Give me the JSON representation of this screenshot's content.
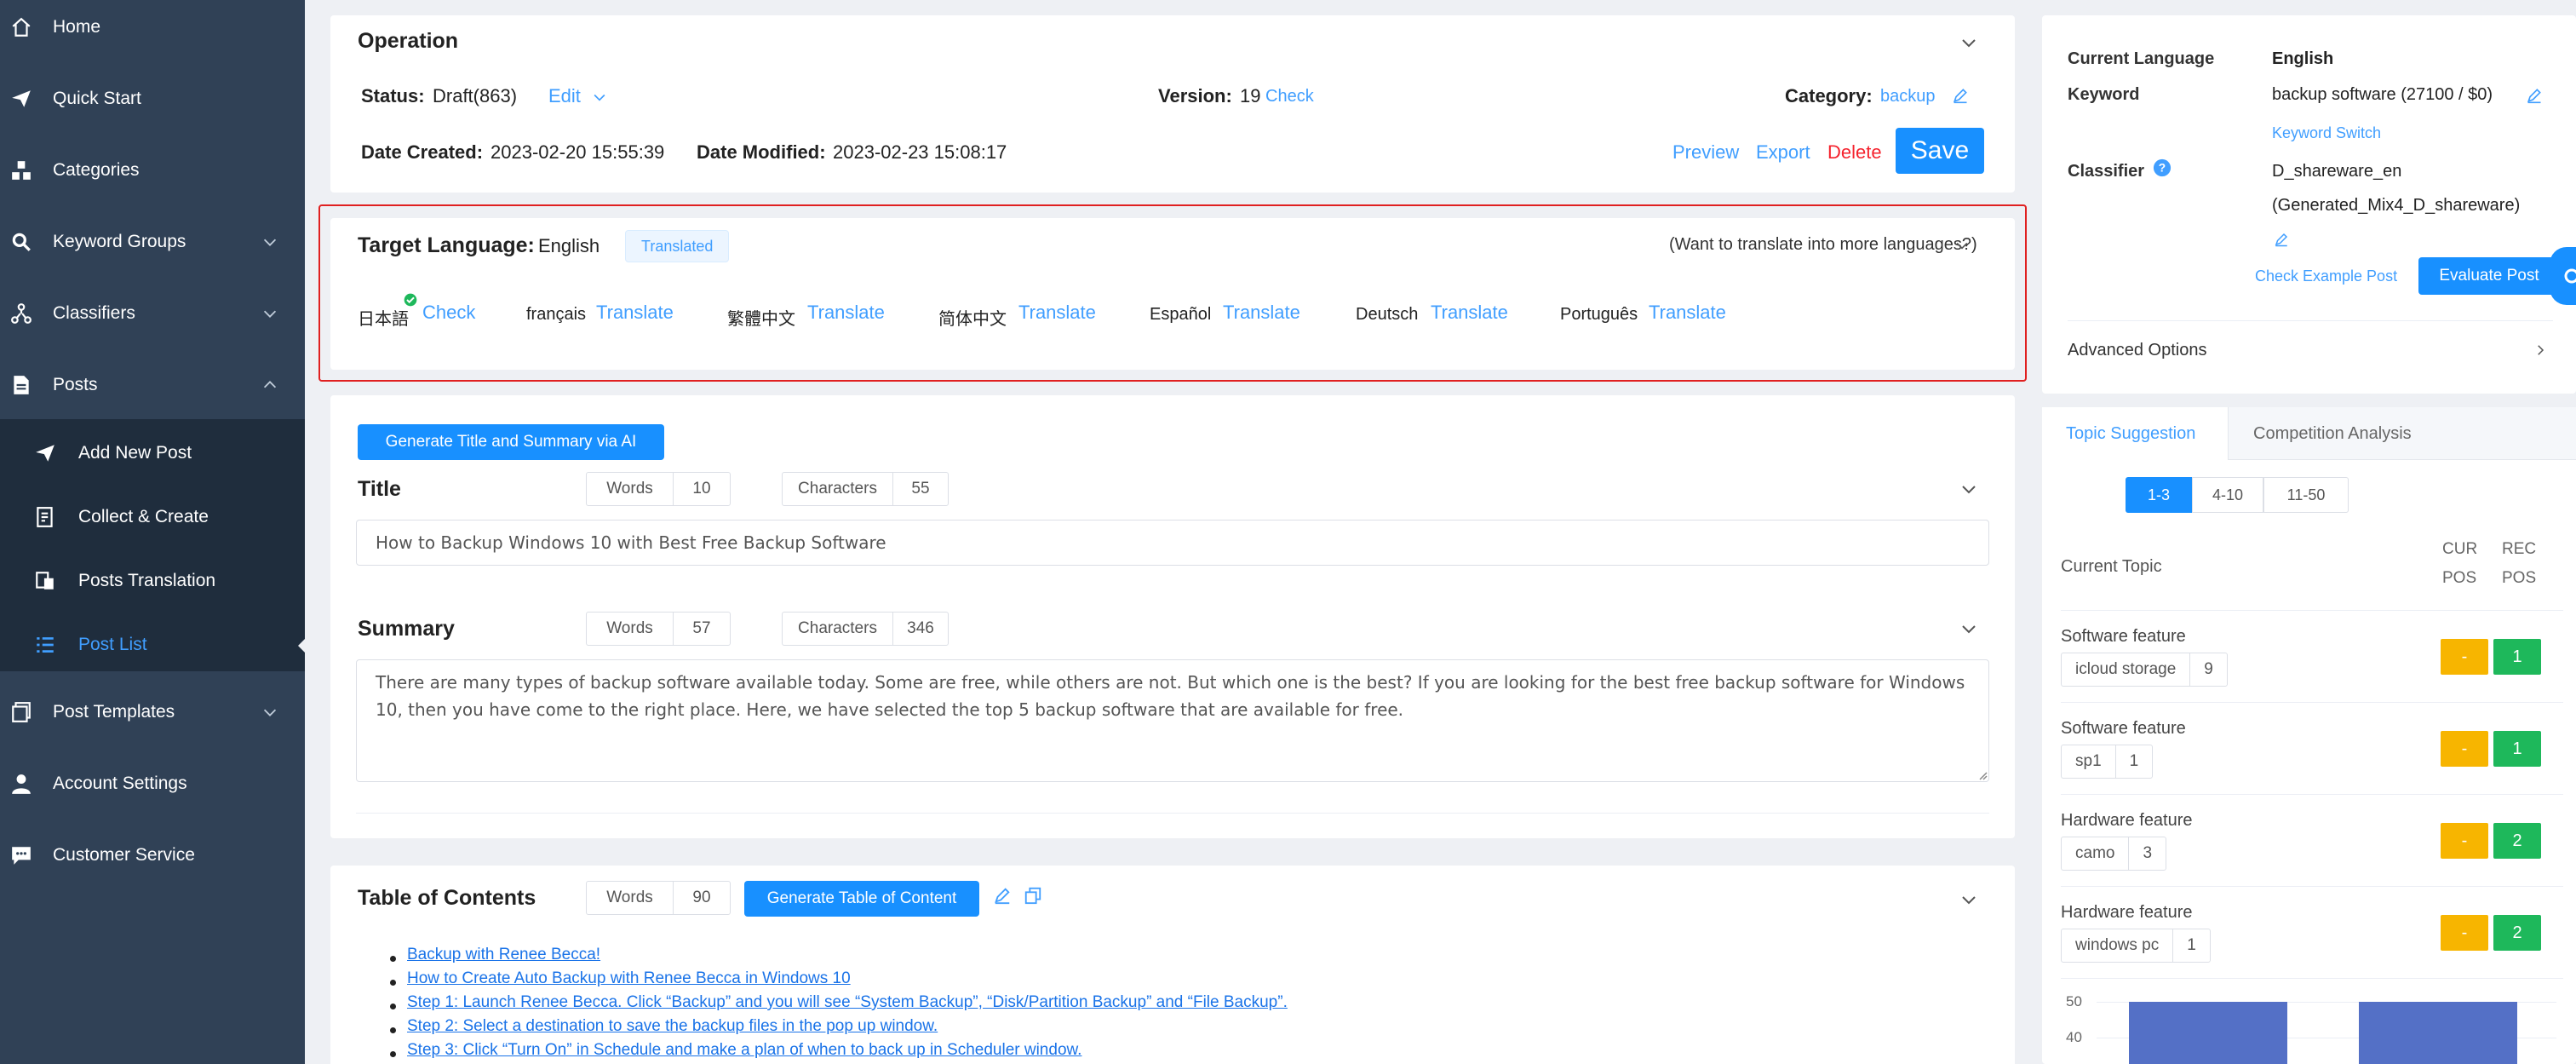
{
  "sidebar": {
    "items": [
      {
        "label": "Home",
        "icon": "home-icon"
      },
      {
        "label": "Quick Start",
        "icon": "send-icon"
      },
      {
        "label": "Categories",
        "icon": "categories-icon"
      },
      {
        "label": "Keyword Groups",
        "icon": "search-icon"
      },
      {
        "label": "Classifiers",
        "icon": "classifier-icon"
      },
      {
        "label": "Posts",
        "icon": "document-icon"
      },
      {
        "label": "Add New Post",
        "icon": "send-icon"
      },
      {
        "label": "Collect & Create",
        "icon": "collect-icon"
      },
      {
        "label": "Posts Translation",
        "icon": "translate-icon"
      },
      {
        "label": "Post List",
        "icon": "list-icon"
      },
      {
        "label": "Post Templates",
        "icon": "template-icon"
      },
      {
        "label": "Account Settings",
        "icon": "user-icon"
      },
      {
        "label": "Customer Service",
        "icon": "chat-icon"
      }
    ]
  },
  "operation": {
    "title": "Operation",
    "status_label": "Status:",
    "status_value": "Draft(863)",
    "edit_label": "Edit",
    "version_label": "Version:",
    "version_value": "19",
    "check_label": "Check",
    "category_label": "Category:",
    "category_value": "backup",
    "date_created_label": "Date Created:",
    "date_created_value": "2023-02-20 15:55:39",
    "date_modified_label": "Date Modified:",
    "date_modified_value": "2023-02-23 15:08:17",
    "preview_label": "Preview",
    "export_label": "Export",
    "delete_label": "Delete",
    "save_label": "Save"
  },
  "target_language": {
    "label": "Target Language:",
    "value": "English",
    "badge": "Translated",
    "more_text": "(Want to translate into more languages?)",
    "languages": [
      {
        "name": "日本語",
        "action": "Check"
      },
      {
        "name": "français",
        "action": "Translate"
      },
      {
        "name": "繁體中文",
        "action": "Translate"
      },
      {
        "name": "简体中文",
        "action": "Translate"
      },
      {
        "name": "Español",
        "action": "Translate"
      },
      {
        "name": "Deutsch",
        "action": "Translate"
      },
      {
        "name": "Português",
        "action": "Translate"
      }
    ]
  },
  "editor": {
    "generate_ai_label": "Generate Title and Summary via AI",
    "title_label": "Title",
    "title_words_label": "Words",
    "title_words": "10",
    "title_chars_label": "Characters",
    "title_chars": "55",
    "title_value": "How to Backup Windows 10 with Best Free Backup Software",
    "summary_label": "Summary",
    "summary_words_label": "Words",
    "summary_words": "57",
    "summary_chars_label": "Characters",
    "summary_chars": "346",
    "summary_value": "There are many types of backup software available today. Some are free, while others are not. But which one is the best? If you are looking for the best free backup software for Windows 10, then you have come to the right place. Here, we have selected the top 5 backup software that are available for free."
  },
  "toc": {
    "title": "Table of Contents",
    "words_label": "Words",
    "words": "90",
    "generate_label": "Generate Table of Content",
    "items": [
      "Backup with Renee Becca!",
      "How to Create Auto Backup with Renee Becca in Windows 10",
      "Step 1: Launch Renee Becca. Click “Backup” and you will see “System Backup”, “Disk/Partition Backup” and “File Backup”.",
      "Step 2: Select a destination to save the backup files in the pop up window.",
      "Step 3: Click “Turn On” in Schedule and make a plan of when to back up in Scheduler window."
    ]
  },
  "right_panel": {
    "current_language_label": "Current Language",
    "current_language_value": "English",
    "keyword_label": "Keyword",
    "keyword_value": "backup software (27100 / $0)",
    "keyword_switch_label": "Keyword Switch",
    "classifier_label": "Classifier",
    "classifier_value_line1": "D_shareware_en",
    "classifier_value_line2": "(Generated_Mix4_D_shareware)",
    "check_example_label": "Check Example Post",
    "evaluate_label": "Evaluate Post",
    "advanced_label": "Advanced Options",
    "tabs": [
      "Topic Suggestion",
      "Competition Analysis"
    ],
    "range_tabs": [
      "1-3",
      "4-10",
      "11-50"
    ],
    "current_topic_label": "Current Topic",
    "cur_pos_label_1": "CUR",
    "cur_pos_label_2": "POS",
    "rec_pos_label_1": "REC",
    "rec_pos_label_2": "POS",
    "topics": [
      {
        "feature": "Software feature",
        "keyword": "icloud storage",
        "count": "9",
        "cur": "-",
        "rec": "1"
      },
      {
        "feature": "Software feature",
        "keyword": "sp1",
        "count": "1",
        "cur": "-",
        "rec": "1"
      },
      {
        "feature": "Hardware feature",
        "keyword": "camo",
        "count": "3",
        "cur": "-",
        "rec": "2"
      },
      {
        "feature": "Hardware feature",
        "keyword": "windows pc",
        "count": "1",
        "cur": "-",
        "rec": "2"
      }
    ],
    "mini_chart": {
      "y_ticks": [
        "50",
        "40"
      ],
      "bar_color": "#5470c6"
    }
  },
  "colors": {
    "sidebar_bg": "#304156",
    "sidebar_sub_bg": "#1f2d3d",
    "accent": "#1890ff",
    "link": "#409eff",
    "danger": "#f5222d",
    "highlight_border": "#e02020",
    "cur_pos": "#f7b500",
    "rec_pos": "#1eb85b"
  }
}
